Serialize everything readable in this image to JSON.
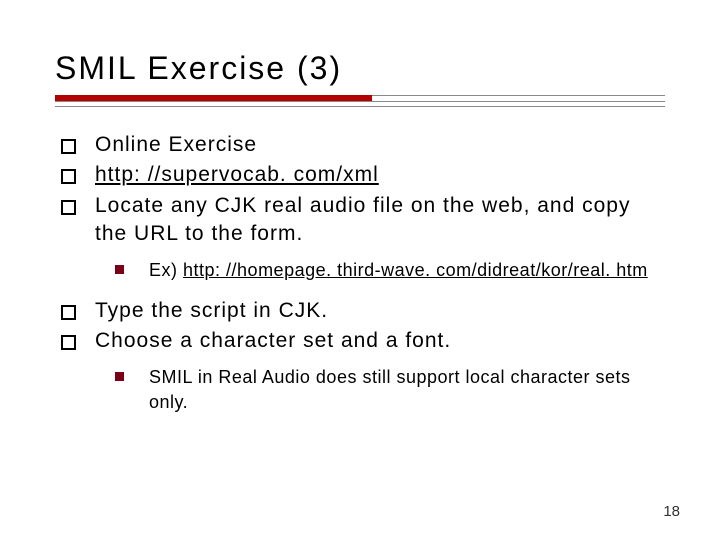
{
  "title": "SMIL Exercise (3)",
  "bullets": {
    "b1": "Online Exercise",
    "b2": "http: //supervocab. com/xml",
    "b3": "Locate any CJK real audio file on the web, and copy the URL to the form.",
    "b3_sub_prefix": "Ex) ",
    "b3_sub_link": "http: //homepage. third-wave. com/didreat/kor/real. htm",
    "b4": "Type the script in CJK.",
    "b5": "Choose a character set and a font.",
    "b5_sub": "SMIL in Real Audio does still support local character sets only."
  },
  "page_number": "18"
}
